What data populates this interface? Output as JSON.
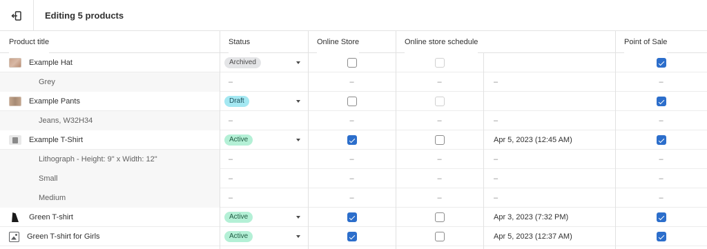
{
  "header": {
    "title": "Editing 5 products"
  },
  "columns": {
    "product_title": "Product title",
    "status": "Status",
    "online_store": "Online Store",
    "online_store_schedule": "Online store schedule",
    "point_of_sale": "Point of Sale"
  },
  "dash": "–",
  "rows": [
    {
      "title": "Example Hat",
      "status": "Archived",
      "date": ""
    },
    {
      "title": "Grey"
    },
    {
      "title": "Example Pants",
      "status": "Draft",
      "date": ""
    },
    {
      "title": "Jeans, W32H34"
    },
    {
      "title": "Example T-Shirt",
      "status": "Active",
      "date": "Apr 5, 2023 (12:45 AM)"
    },
    {
      "title": "Lithograph - Height: 9\" x Width: 12\""
    },
    {
      "title": "Small"
    },
    {
      "title": "Medium"
    },
    {
      "title": "Green T-shirt",
      "status": "Active",
      "date": "Apr 3, 2023 (7:32 PM)"
    },
    {
      "title": "Green T-shirt for Girls",
      "status": "Active",
      "date": "Apr 5, 2023 (12:37 AM)"
    }
  ],
  "colors": {
    "checkbox_checked": "#2c6ecb",
    "badge_active": "#b4f0d6",
    "badge_draft": "#a4e8f2",
    "badge_archived": "#e4e5e7"
  }
}
